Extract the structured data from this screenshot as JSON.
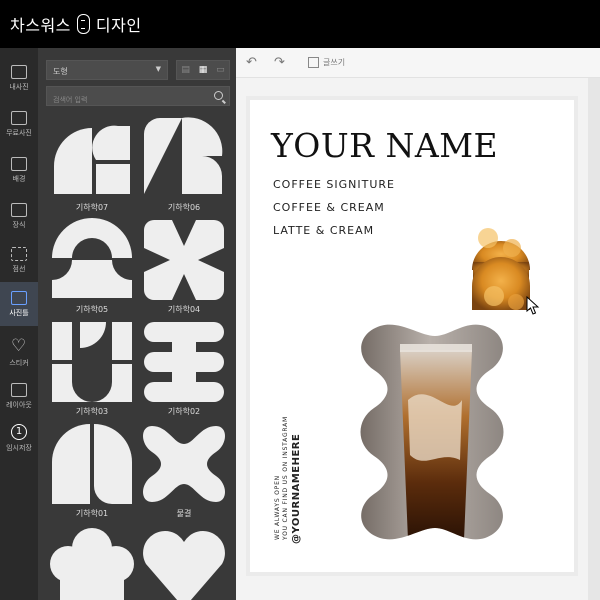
{
  "app": {
    "title_left": "차스워스",
    "title_right": "디자인"
  },
  "rail": {
    "items": [
      {
        "label": "내사진",
        "icon": "photo-folder-icon"
      },
      {
        "label": "무료사진",
        "icon": "free-photo-icon"
      },
      {
        "label": "배경",
        "icon": "background-icon"
      },
      {
        "label": "장식",
        "icon": "decoration-icon"
      },
      {
        "label": "점선",
        "icon": "dotted-line-icon"
      },
      {
        "label": "사진틀",
        "icon": "photo-frame-icon"
      },
      {
        "label": "스티커",
        "icon": "heart-icon"
      },
      {
        "label": "레이아웃",
        "icon": "layout-icon"
      },
      {
        "label": "임시저장",
        "icon": "temp-save-icon",
        "badge": "1"
      }
    ],
    "active_index": 5
  },
  "panel": {
    "dropdown_value": "도형",
    "search_placeholder": "검색어 입력",
    "tiles": [
      {
        "label": "기하학07"
      },
      {
        "label": "기하학06"
      },
      {
        "label": "기하학05"
      },
      {
        "label": "기하학04"
      },
      {
        "label": "기하학03"
      },
      {
        "label": "기하학02"
      },
      {
        "label": "기하학01"
      },
      {
        "label": "물결"
      },
      {
        "label": ""
      },
      {
        "label": ""
      }
    ]
  },
  "toolbar": {
    "grid_label": "글쓰기"
  },
  "poster": {
    "name": "YOUR NAME",
    "menu": [
      "COFFEE SIGNITURE",
      "COFFEE & CREAM",
      "LATTE & CREAM"
    ],
    "vertical_line1": "WE ALWAYS OPEN",
    "vertical_line2": "YOU CAN FIND US ON INSTAGRAM",
    "handle": "@YOURNAMEHERE"
  },
  "colors": {
    "accent": "#6aa0ff",
    "panel": "#393939",
    "rail": "#2a2a2a",
    "shape": "#eeeeee"
  }
}
